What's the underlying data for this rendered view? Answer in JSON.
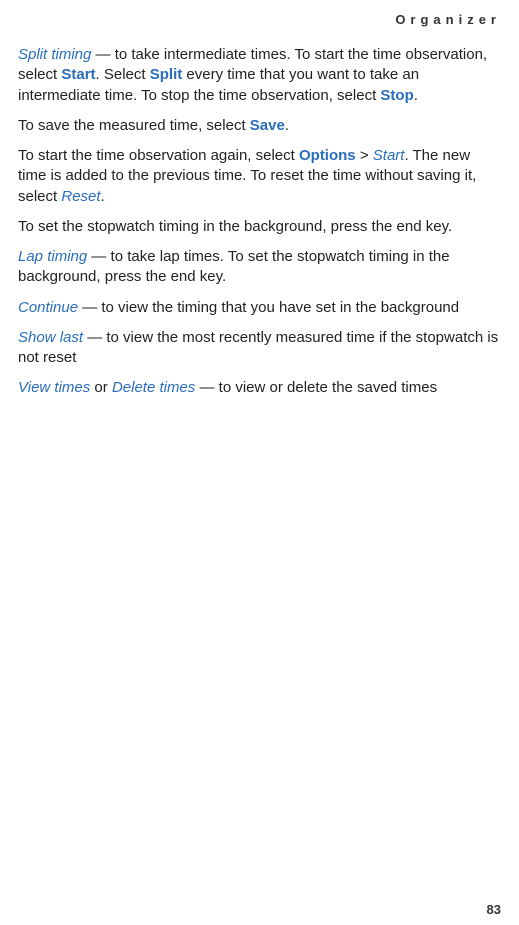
{
  "header": "Organizer",
  "p1": {
    "t1": "Split timing",
    "t2": " — to take intermediate times. To start the time observation, select ",
    "t3": "Start",
    "t4": ". Select ",
    "t5": "Split",
    "t6": " every time that you want to take an intermediate time. To stop the time observation, select ",
    "t7": "Stop",
    "t8": "."
  },
  "p2": {
    "t1": "To save the measured time, select ",
    "t2": "Save",
    "t3": "."
  },
  "p3": {
    "t1": "To start the time observation again, select ",
    "t2": "Options",
    "t3": " > ",
    "t4": "Start",
    "t5": ". The new time is added to the previous time. To reset the time without saving it, select ",
    "t6": "Reset",
    "t7": "."
  },
  "p4": "To set the stopwatch timing in the background, press the end key.",
  "p5": {
    "t1": "Lap timing",
    "t2": " — to take lap times. To set the stopwatch timing in the background, press the end key."
  },
  "p6": {
    "t1": "Continue",
    "t2": " — to view the timing that you have set in the background"
  },
  "p7": {
    "t1": "Show last",
    "t2": " — to view the most recently measured time if the stopwatch is not reset"
  },
  "p8": {
    "t1": "View times",
    "t2": " or ",
    "t3": "Delete times",
    "t4": " — to view or delete the saved times"
  },
  "pageNumber": "83"
}
